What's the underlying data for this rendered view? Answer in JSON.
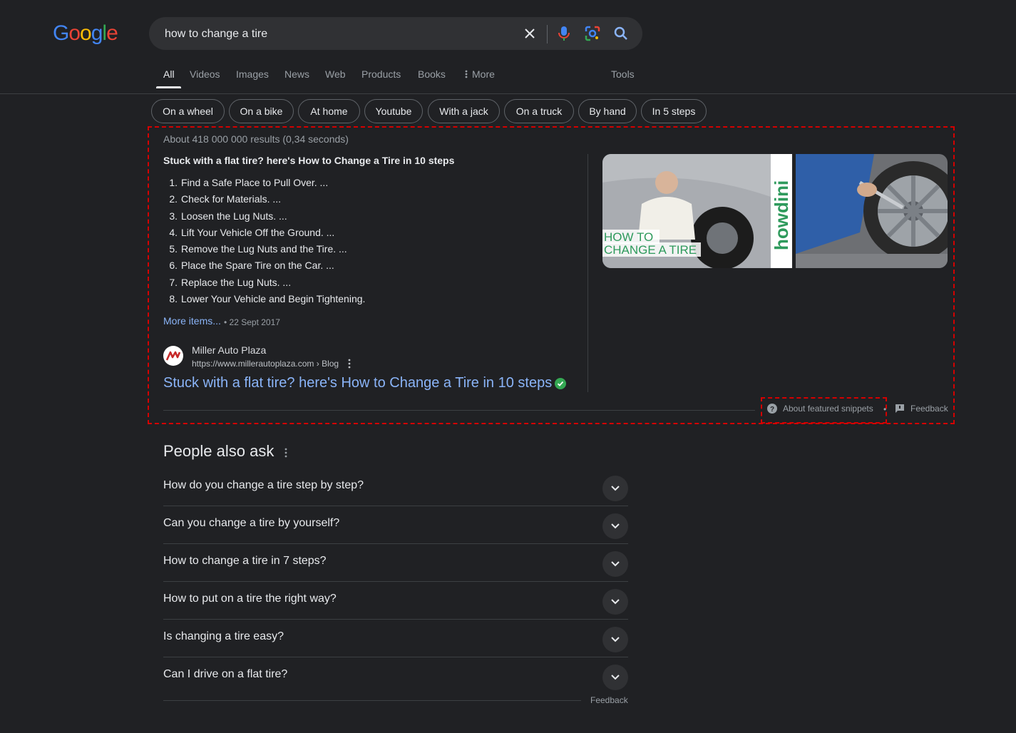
{
  "logo": {
    "text": "Google"
  },
  "search": {
    "query": "how to change a tire"
  },
  "tabs": [
    "All",
    "Videos",
    "Images",
    "News",
    "Web",
    "Products",
    "Books",
    "More",
    "Tools"
  ],
  "chips": [
    "On a wheel",
    "On a bike",
    "At home",
    "Youtube",
    "With a jack",
    "On a truck",
    "By hand",
    "In 5 steps"
  ],
  "results_count": "About 418 000 000 results (0,34 seconds)",
  "snippet": {
    "title": "Stuck with a flat tire? here's How to Change a Tire in 10 steps",
    "steps": [
      "Find a Safe Place to Pull Over. ...",
      "Check for Materials. ...",
      "Loosen the Lug Nuts. ...",
      "Lift Your Vehicle Off the Ground. ...",
      "Remove the Lug Nuts and the Tire. ...",
      "Place the Spare Tire on the Car. ...",
      "Replace the Lug Nuts. ...",
      "Lower Your Vehicle and Begin Tightening."
    ],
    "more_items": "More items...",
    "date": "22 Sept 2017",
    "source_name": "Miller Auto Plaza",
    "source_url": "https://www.millerautoplaza.com › Blog",
    "link_title": "Stuck with a flat tire? here's How to Change a Tire in 10 steps",
    "image_caption_line1": "HOW TO",
    "image_caption_line2": "CHANGE A TIRE",
    "image_brand": "howdini",
    "about_label": "About featured snippets",
    "feedback_label": "Feedback"
  },
  "paa": {
    "title": "People also ask",
    "questions": [
      "How do you change a tire step by step?",
      "Can you change a tire by yourself?",
      "How to change a tire in 7 steps?",
      "How to put on a tire the right way?",
      "Is changing a tire easy?",
      "Can I drive on a flat tire?"
    ],
    "feedback_label": "Feedback"
  },
  "colors": {
    "background": "#202124",
    "link": "#8ab4f8",
    "highlight_border": "#d50000"
  }
}
